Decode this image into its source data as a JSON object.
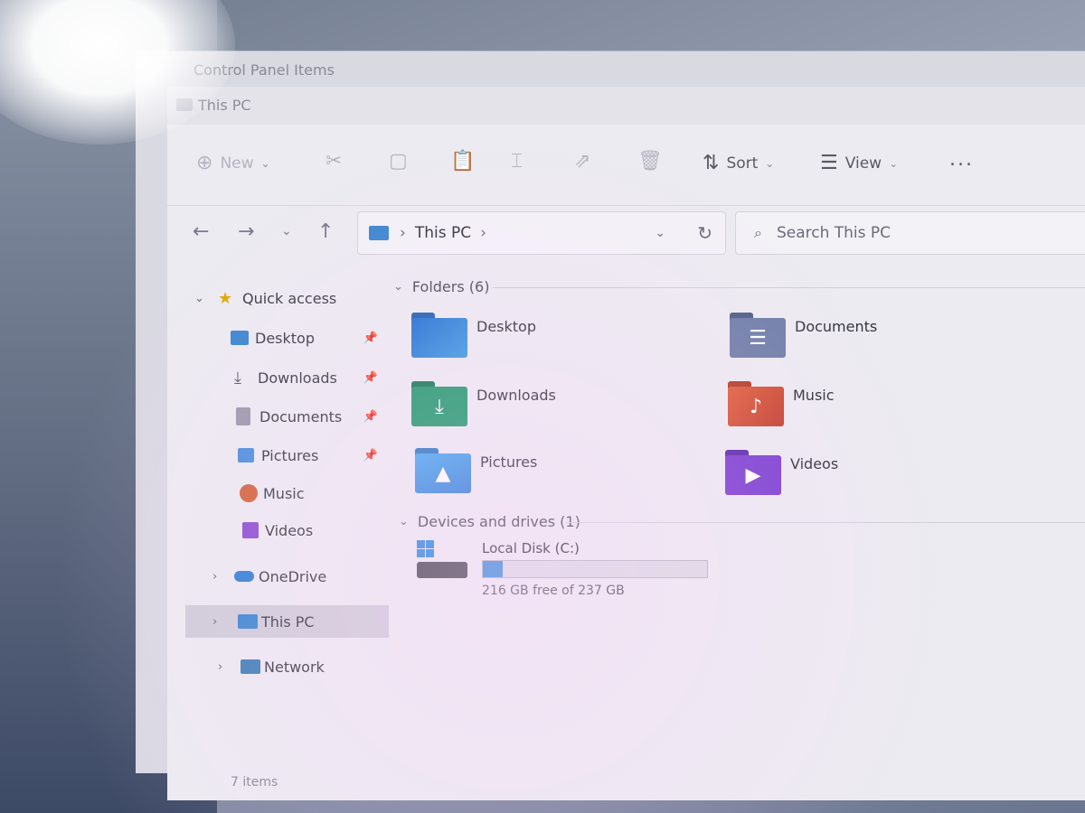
{
  "background_window": {
    "title": "Control Panel Items"
  },
  "window": {
    "title": "This PC"
  },
  "toolbar": {
    "new_label": "New",
    "sort_label": "Sort",
    "view_label": "View",
    "more_label": "..."
  },
  "address": {
    "location": "This PC",
    "search_placeholder": "Search This PC"
  },
  "sidebar": {
    "quick_access": "Quick access",
    "items": [
      {
        "label": "Desktop",
        "pinned": true
      },
      {
        "label": "Downloads",
        "pinned": true
      },
      {
        "label": "Documents",
        "pinned": true
      },
      {
        "label": "Pictures",
        "pinned": true
      },
      {
        "label": "Music",
        "pinned": false
      },
      {
        "label": "Videos",
        "pinned": false
      }
    ],
    "onedrive": "OneDrive",
    "this_pc": "This PC",
    "network": "Network"
  },
  "content": {
    "folders_header": "Folders (6)",
    "folders": [
      {
        "label": "Desktop",
        "color": "#2f7fd6"
      },
      {
        "label": "Documents",
        "color": "#6f7fa8"
      },
      {
        "label": "Downloads",
        "color": "#1f9a6b"
      },
      {
        "label": "Music",
        "color": "#d9533a"
      },
      {
        "label": "Pictures",
        "color": "#3a9ae0"
      },
      {
        "label": "Videos",
        "color": "#7b3fd0"
      }
    ],
    "devices_header": "Devices and drives (1)",
    "drive": {
      "label": "Local Disk (C:)",
      "free_text": "216 GB free of 237 GB",
      "used_fraction": 0.0886
    }
  },
  "status": {
    "items_text": "7 items"
  }
}
